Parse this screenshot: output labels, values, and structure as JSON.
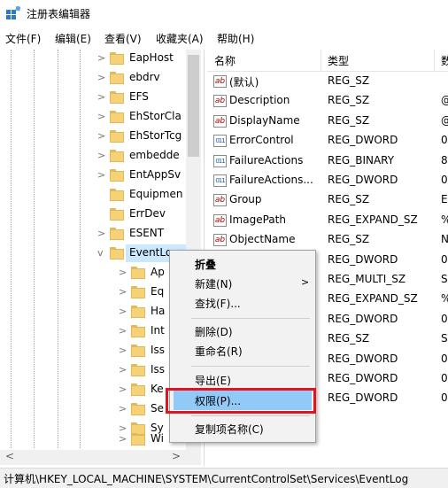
{
  "window": {
    "title": "注册表编辑器"
  },
  "menubar": [
    "文件(F)",
    "编辑(E)",
    "查看(V)",
    "收藏夹(A)",
    "帮助(H)"
  ],
  "tree": {
    "items": [
      {
        "label": "EapHost",
        "expander": ">"
      },
      {
        "label": "ebdrv",
        "expander": ">"
      },
      {
        "label": "EFS",
        "expander": ">"
      },
      {
        "label": "EhStorCla",
        "expander": ">"
      },
      {
        "label": "EhStorTcg",
        "expander": ">"
      },
      {
        "label": "embedde",
        "expander": ">"
      },
      {
        "label": "EntAppSv",
        "expander": ">"
      },
      {
        "label": "Equipmen",
        "expander": ""
      },
      {
        "label": "ErrDev",
        "expander": ""
      },
      {
        "label": "ESENT",
        "expander": ">"
      },
      {
        "label": "EventLog",
        "expander": "v"
      },
      {
        "label": "Ap",
        "expander": ">"
      },
      {
        "label": "Eq",
        "expander": ">"
      },
      {
        "label": "Ha",
        "expander": ">"
      },
      {
        "label": "Int",
        "expander": ">"
      },
      {
        "label": "Iss",
        "expander": ">"
      },
      {
        "label": "Iss",
        "expander": ">"
      },
      {
        "label": "Ke",
        "expander": ">"
      },
      {
        "label": "Se",
        "expander": ">"
      },
      {
        "label": "Sy",
        "expander": ">"
      },
      {
        "label": "Wi",
        "expander": ">"
      }
    ],
    "scroll_left": "<",
    "scroll_right": ">"
  },
  "list": {
    "headers": {
      "name": "名称",
      "type": "类型",
      "data": "数"
    },
    "rows": [
      {
        "icon": "ab",
        "name": "(默认)",
        "type": "REG_SZ",
        "data": ""
      },
      {
        "icon": "ab",
        "name": "Description",
        "type": "REG_SZ",
        "data": "@"
      },
      {
        "icon": "ab",
        "name": "DisplayName",
        "type": "REG_SZ",
        "data": "@"
      },
      {
        "icon": "011",
        "name": "ErrorControl",
        "type": "REG_DWORD",
        "data": "0"
      },
      {
        "icon": "011",
        "name": "FailureActions",
        "type": "REG_BINARY",
        "data": "8"
      },
      {
        "icon": "011",
        "name": "FailureActions...",
        "type": "REG_DWORD",
        "data": "0"
      },
      {
        "icon": "ab",
        "name": "Group",
        "type": "REG_SZ",
        "data": "E"
      },
      {
        "icon": "ab",
        "name": "ImagePath",
        "type": "REG_EXPAND_SZ",
        "data": "%"
      },
      {
        "icon": "ab",
        "name": "ObjectName",
        "type": "REG_SZ",
        "data": "N"
      },
      {
        "icon": "",
        "name": "",
        "type": "REG_DWORD",
        "data": "0"
      },
      {
        "icon": "",
        "name": "",
        "type": "REG_MULTI_SZ",
        "data": "S"
      },
      {
        "icon": "",
        "name": "",
        "type": "REG_EXPAND_SZ",
        "data": "%"
      },
      {
        "icon": "",
        "name": "",
        "type": "REG_DWORD",
        "data": "0"
      },
      {
        "icon": "",
        "name": "",
        "type": "REG_SZ",
        "data": "S"
      },
      {
        "icon": "",
        "name": "",
        "type": "REG_DWORD",
        "data": "0"
      },
      {
        "icon": "",
        "name": "",
        "type": "REG_DWORD",
        "data": "0"
      },
      {
        "icon": "",
        "name": "",
        "type": "REG_DWORD",
        "data": "0"
      }
    ]
  },
  "context_menu": {
    "collapse": "折叠",
    "new": "新建(N)",
    "new_arrow": ">",
    "find": "查找(F)...",
    "delete": "删除(D)",
    "rename": "重命名(R)",
    "export": "导出(E)",
    "permissions": "权限(P)...",
    "copy_key_name": "复制项名称(C)"
  },
  "statusbar": {
    "path": "计算机\\HKEY_LOCAL_MACHINE\\SYSTEM\\CurrentControlSet\\Services\\EventLog"
  },
  "colors": {
    "selection": "#cce8ff",
    "menu_highlight": "#91c9f7",
    "callout": "#e0141e"
  }
}
